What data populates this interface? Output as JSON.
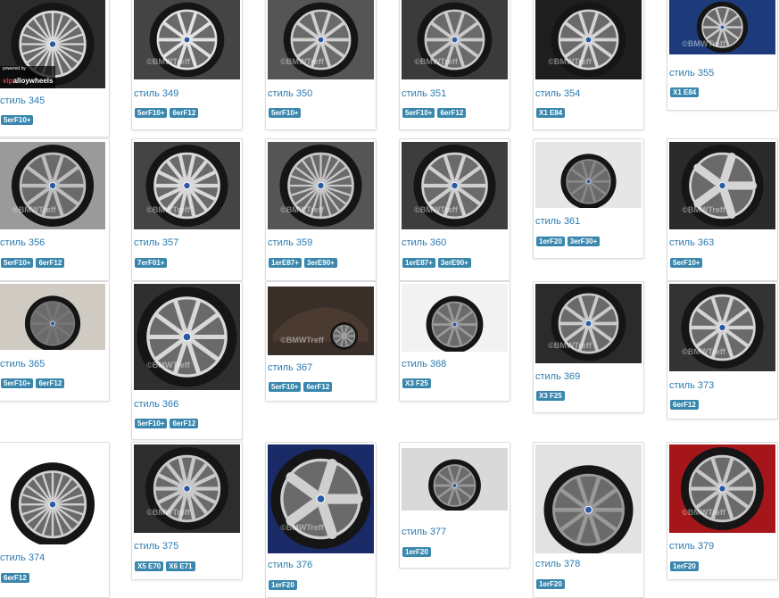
{
  "watermark": "©BMWTreff",
  "vip_badge": {
    "powered": "powered by",
    "brand_a": "vip",
    "brand_b": "alloywheels"
  },
  "colors": {
    "title": "#2a7ab0",
    "badge": "#3a87ad"
  },
  "wheels": [
    {
      "title": "стиль 345",
      "tags": [
        "5erF10+"
      ]
    },
    {
      "title": "стиль 349",
      "tags": [
        "5erF10+",
        "6erF12"
      ]
    },
    {
      "title": "стиль 350",
      "tags": [
        "5erF10+"
      ]
    },
    {
      "title": "стиль 351",
      "tags": [
        "5erF10+",
        "6erF12"
      ]
    },
    {
      "title": "стиль 354",
      "tags": [
        "X1 E84"
      ]
    },
    {
      "title": "стиль 355",
      "tags": [
        "X1 E84"
      ]
    },
    {
      "title": "стиль 356",
      "tags": [
        "5erF10+",
        "6erF12"
      ]
    },
    {
      "title": "стиль 357",
      "tags": [
        "7erF01+"
      ]
    },
    {
      "title": "стиль 359",
      "tags": [
        "1erE87+",
        "3erE90+"
      ]
    },
    {
      "title": "стиль 360",
      "tags": [
        "1erE87+",
        "3erE90+"
      ]
    },
    {
      "title": "стиль 361",
      "tags": [
        "1erF20",
        "3erF30+"
      ]
    },
    {
      "title": "стиль 363",
      "tags": [
        "5erF10+"
      ]
    },
    {
      "title": "стиль 365",
      "tags": [
        "5erF10+",
        "6erF12"
      ]
    },
    {
      "title": "стиль 366",
      "tags": [
        "5erF10+",
        "6erF12"
      ]
    },
    {
      "title": "стиль 367",
      "tags": [
        "5erF10+",
        "6erF12"
      ]
    },
    {
      "title": "стиль 368",
      "tags": [
        "X3 F25"
      ]
    },
    {
      "title": "стиль 369",
      "tags": [
        "X3 F25"
      ]
    },
    {
      "title": "стиль 373",
      "tags": [
        "6erF12"
      ]
    },
    {
      "title": "стиль 374",
      "tags": [
        "6erF12"
      ]
    },
    {
      "title": "стиль 375",
      "tags": [
        "X5 E70",
        "X6 E71"
      ]
    },
    {
      "title": "стиль 376",
      "tags": [
        "1erF20"
      ]
    },
    {
      "title": "стиль 377",
      "tags": [
        "1erF20"
      ]
    },
    {
      "title": "стиль 378",
      "tags": [
        "1erF20"
      ]
    },
    {
      "title": "стиль 379",
      "tags": [
        "1erF20"
      ]
    }
  ]
}
